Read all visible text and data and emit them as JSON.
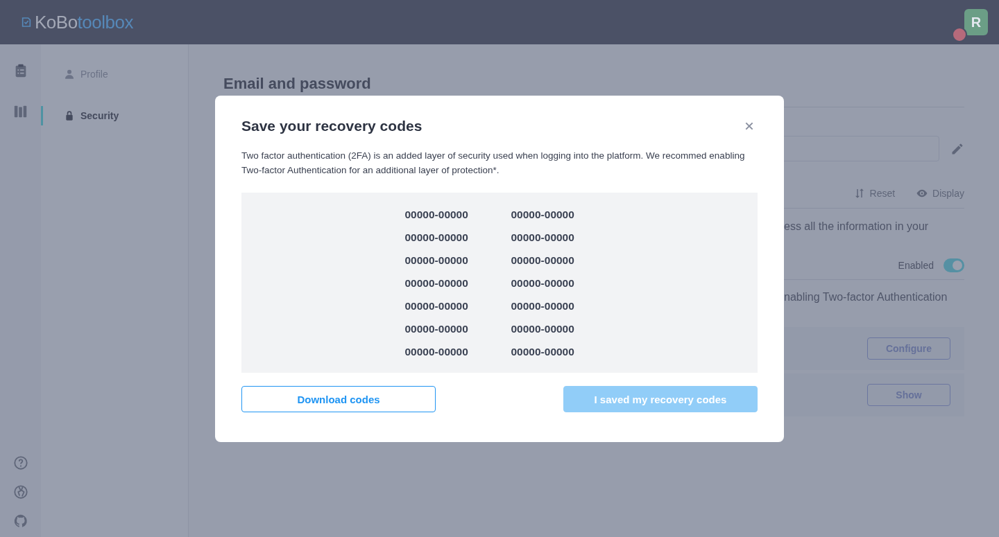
{
  "header": {
    "logo": {
      "part_1": "KoBo",
      "part_2": "toolbox"
    },
    "avatar": {
      "initial": "R"
    }
  },
  "nav": {
    "items": [
      {
        "label": "Profile",
        "selected": false
      },
      {
        "label": "Security",
        "selected": true
      }
    ]
  },
  "main": {
    "heading": "Email and password",
    "actions": [
      "Reset",
      "Display"
    ],
    "info_fragment": "ess all the information in your",
    "status": "Enabled",
    "toggle": {
      "on": true
    },
    "twofa_fragment": "nabling Two-factor Authentication",
    "buttons": [
      "Configure",
      "Show"
    ]
  },
  "modal": {
    "title": "Save your recovery codes",
    "description": "Two factor authentication (2FA) is an added layer of security used when logging into the platform. We recommed enabling Two-factor Authentication for an additional layer of protection*.",
    "codes": [
      "00000-00000",
      "00000-00000",
      "00000-00000",
      "00000-00000",
      "00000-00000",
      "00000-00000",
      "00000-00000",
      "00000-00000",
      "00000-00000",
      "00000-00000",
      "00000-00000",
      "00000-00000",
      "00000-00000",
      "00000-00000"
    ],
    "buttons": [
      {
        "label": "Download codes",
        "kind": "outline",
        "disabled": false
      },
      {
        "label": "I saved my recovery codes",
        "kind": "primary",
        "disabled": true
      }
    ]
  }
}
